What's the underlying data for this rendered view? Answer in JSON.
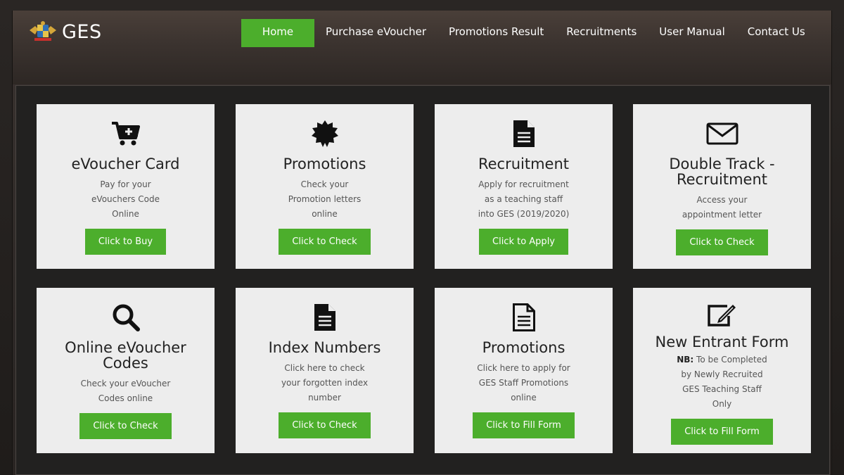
{
  "header": {
    "logo_text": "GES",
    "nav": [
      {
        "label": "Home",
        "active": true
      },
      {
        "label": "Purchase eVoucher"
      },
      {
        "label": "Promotions Result"
      },
      {
        "label": "Recruitments"
      },
      {
        "label": "User Manual"
      },
      {
        "label": "Contact Us"
      }
    ]
  },
  "cards": [
    {
      "icon": "cart-plus-icon",
      "title": "eVoucher Card",
      "desc": [
        "Pay for your",
        "eVouchers Code",
        "Online"
      ],
      "button": "Click to Buy"
    },
    {
      "icon": "certificate-icon",
      "title": "Promotions",
      "desc": [
        "Check your",
        "Promotion letters",
        "online"
      ],
      "button": "Click to Check"
    },
    {
      "icon": "document-icon",
      "title": "Recruitment",
      "desc": [
        "Apply for recruitment",
        "as a teaching staff",
        "into GES (2019/2020)"
      ],
      "button": "Click to Apply"
    },
    {
      "icon": "envelope-icon",
      "title_lines": [
        "Double Track -",
        "Recruitment"
      ],
      "desc": [
        "Access your",
        "appointment letter"
      ],
      "button": "Click to Check"
    },
    {
      "icon": "search-icon",
      "title_lines": [
        "Online eVoucher",
        "Codes"
      ],
      "desc": [
        "Check your eVoucher",
        "Codes online"
      ],
      "button": "Click to Check"
    },
    {
      "icon": "document-icon",
      "title": "Index Numbers",
      "desc": [
        "Click here to check",
        "your forgotten index",
        "number"
      ],
      "button": "Click to Check"
    },
    {
      "icon": "document-outline-icon",
      "title": "Promotions",
      "desc": [
        "Click here to apply for",
        "GES Staff Promotions",
        "online"
      ],
      "button": "Click to Fill Form"
    },
    {
      "icon": "edit-icon",
      "title": "New Entrant Form",
      "desc_prefix": "NB:",
      "desc": [
        " To be Completed",
        "by Newly Recruited",
        "GES Teaching Staff",
        "Only"
      ],
      "button": "Click to Fill Form"
    }
  ],
  "colors": {
    "accent_green": "#4cae2c",
    "card_bg": "#ededed",
    "panel_bg": "#222120"
  }
}
